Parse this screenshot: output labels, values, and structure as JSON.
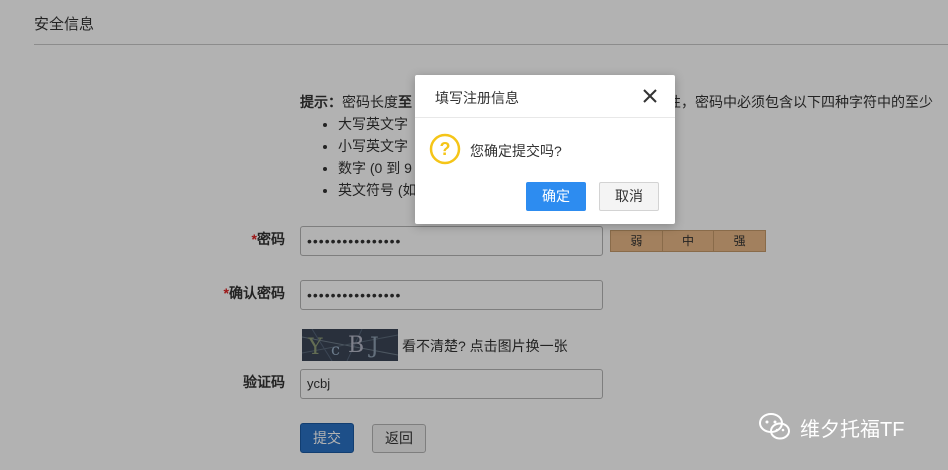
{
  "section": {
    "title": "安全信息"
  },
  "hint": {
    "label": "提示：",
    "text_pre": "密码长度",
    "text_bold": "至",
    "text_post": "性，密码中必须包含以下四种字符中的至少",
    "items": [
      "大写英文字",
      "小写英文字",
      "数字 (0 到 9",
      "英文符号 (如"
    ]
  },
  "form": {
    "password": {
      "required_mark": "*",
      "label": "密码",
      "value": "••••••••••••••••"
    },
    "strength": [
      "弱",
      "中",
      "强"
    ],
    "confirm": {
      "required_mark": "*",
      "label": "确认密码",
      "value": "••••••••••••••••"
    },
    "captcha": {
      "image_text": "YcBJ",
      "hint": "看不清楚? 点击图片换一张"
    },
    "verify": {
      "label": "验证码",
      "value": "ycbj"
    },
    "submit_label": "提交",
    "back_label": "返回"
  },
  "dialog": {
    "title": "填写注册信息",
    "message": "您确定提交吗?",
    "ok_label": "确定",
    "cancel_label": "取消"
  },
  "watermark": {
    "text": "维夕托福TF"
  },
  "colors": {
    "primary": "#2d8cf0",
    "submit": "#2a72c4",
    "strength": "#e9b887",
    "question": "#f5c518",
    "required": "#e02020"
  }
}
